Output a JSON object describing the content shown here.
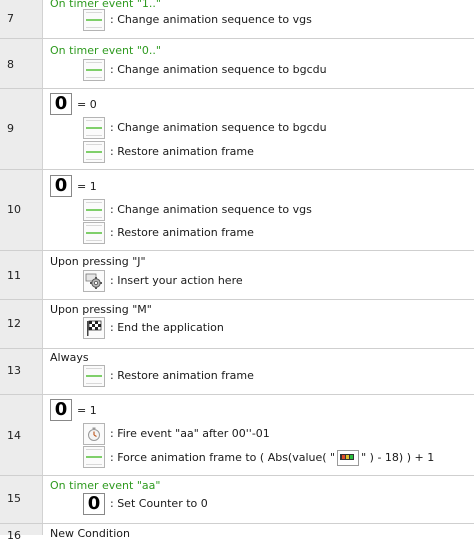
{
  "rows": [
    {
      "num": "7",
      "condition": "On timer event \"1..\"",
      "actions": [
        {
          "text": ": Change animation sequence to vgs"
        }
      ]
    },
    {
      "num": "8",
      "condition": "On timer event \"0..\"",
      "actions": [
        {
          "text": ": Change animation sequence to bgcdu"
        }
      ]
    },
    {
      "num": "9",
      "condition": "= 0",
      "actions": [
        {
          "text": ": Change animation sequence to bgcdu"
        },
        {
          "text": ": Restore animation frame"
        }
      ]
    },
    {
      "num": "10",
      "condition": "= 1",
      "actions": [
        {
          "text": ": Change animation sequence to vgs"
        },
        {
          "text": ": Restore animation frame"
        }
      ]
    },
    {
      "num": "11",
      "condition": "Upon pressing \"J\"",
      "actions": [
        {
          "text": ": Insert your action here"
        }
      ]
    },
    {
      "num": "12",
      "condition": "Upon pressing \"M\"",
      "actions": [
        {
          "text": ": End the application"
        }
      ]
    },
    {
      "num": "13",
      "condition": "Always",
      "actions": [
        {
          "text": ": Restore animation frame"
        }
      ]
    },
    {
      "num": "14",
      "condition": "= 1",
      "actions": [
        {
          "text": ": Fire event \"aa\" after 00''-01"
        },
        {
          "text_a": ": Force animation frame to ( Abs(value( \"",
          "text_b": "\" ) - 18) ) + 1"
        }
      ]
    },
    {
      "num": "15",
      "condition": "On timer event \"aa\"",
      "actions": [
        {
          "text": ": Set Counter to 0"
        }
      ]
    },
    {
      "num": "16",
      "condition": "New Condition"
    }
  ],
  "counter_glyph": "0",
  "colors": {
    "timer_condition": "#2e9a1f",
    "gutter": "#ececec",
    "row_border": "#cfcfcf"
  },
  "icons": [
    "animation-icon",
    "counter-icon",
    "keyboard-gear-icon",
    "checkered-flag-icon",
    "timer-icon",
    "counter-object-icon"
  ]
}
